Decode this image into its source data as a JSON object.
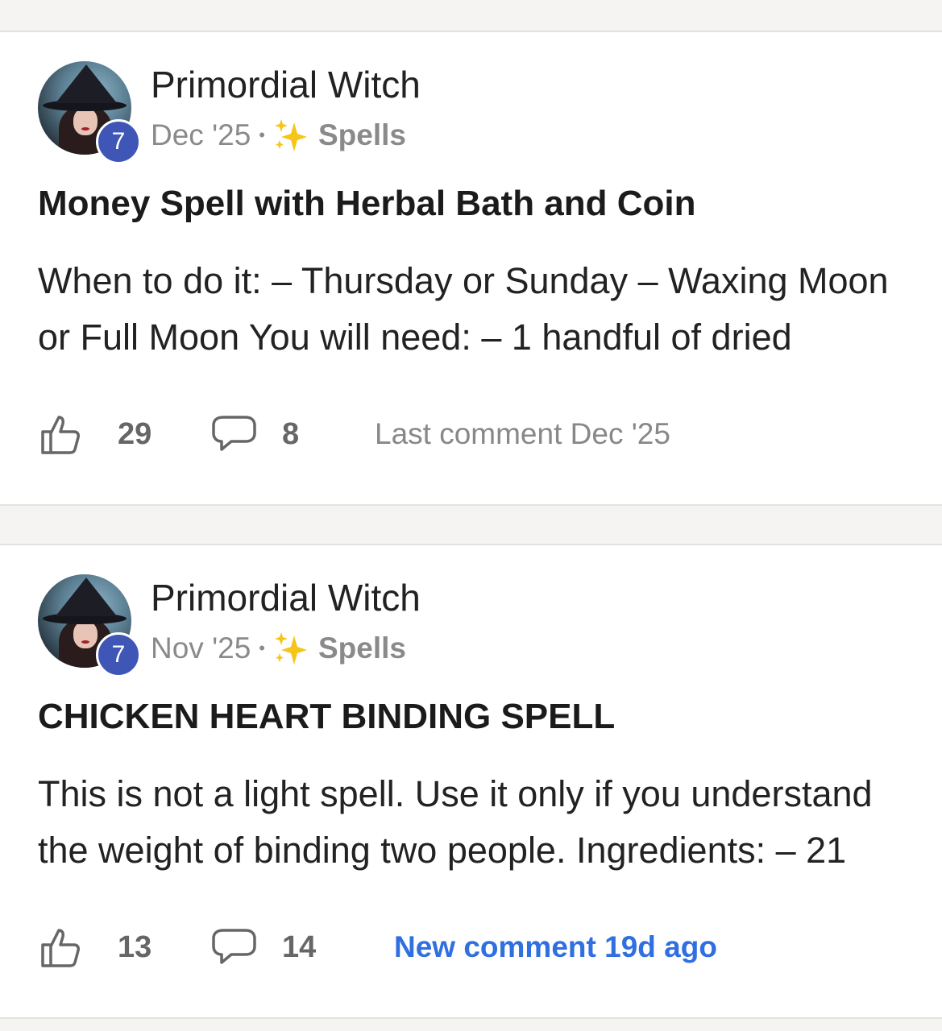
{
  "posts": [
    {
      "author": "Primordial Witch",
      "level": "7",
      "date": "Dec '25",
      "separator": "•",
      "category": "Spells",
      "title": "Money Spell with Herbal Bath and Coin",
      "excerpt": "When to do it: – Thursday or Sunday – Waxing Moon or Full Moon You will need: – 1 handful of dried",
      "likes": "29",
      "comments": "8",
      "activity": "Last comment Dec '25"
    },
    {
      "author": "Primordial Witch",
      "level": "7",
      "date": "Nov '25",
      "separator": "•",
      "category": "Spells",
      "title": "CHICKEN HEART BINDING SPELL",
      "excerpt": "This is not a light spell. Use it only if you understand the weight of binding two people. Ingredients: – 21",
      "likes": "13",
      "comments": "14",
      "activity": "New comment 19d ago"
    }
  ],
  "colors": {
    "badge": "#3f56b6",
    "new_comment": "#2f6fe0",
    "sparkle": "#f5c518"
  },
  "icons": {
    "like": "thumbs-up-icon",
    "comment": "speech-bubble-icon",
    "category": "sparkles-icon"
  }
}
